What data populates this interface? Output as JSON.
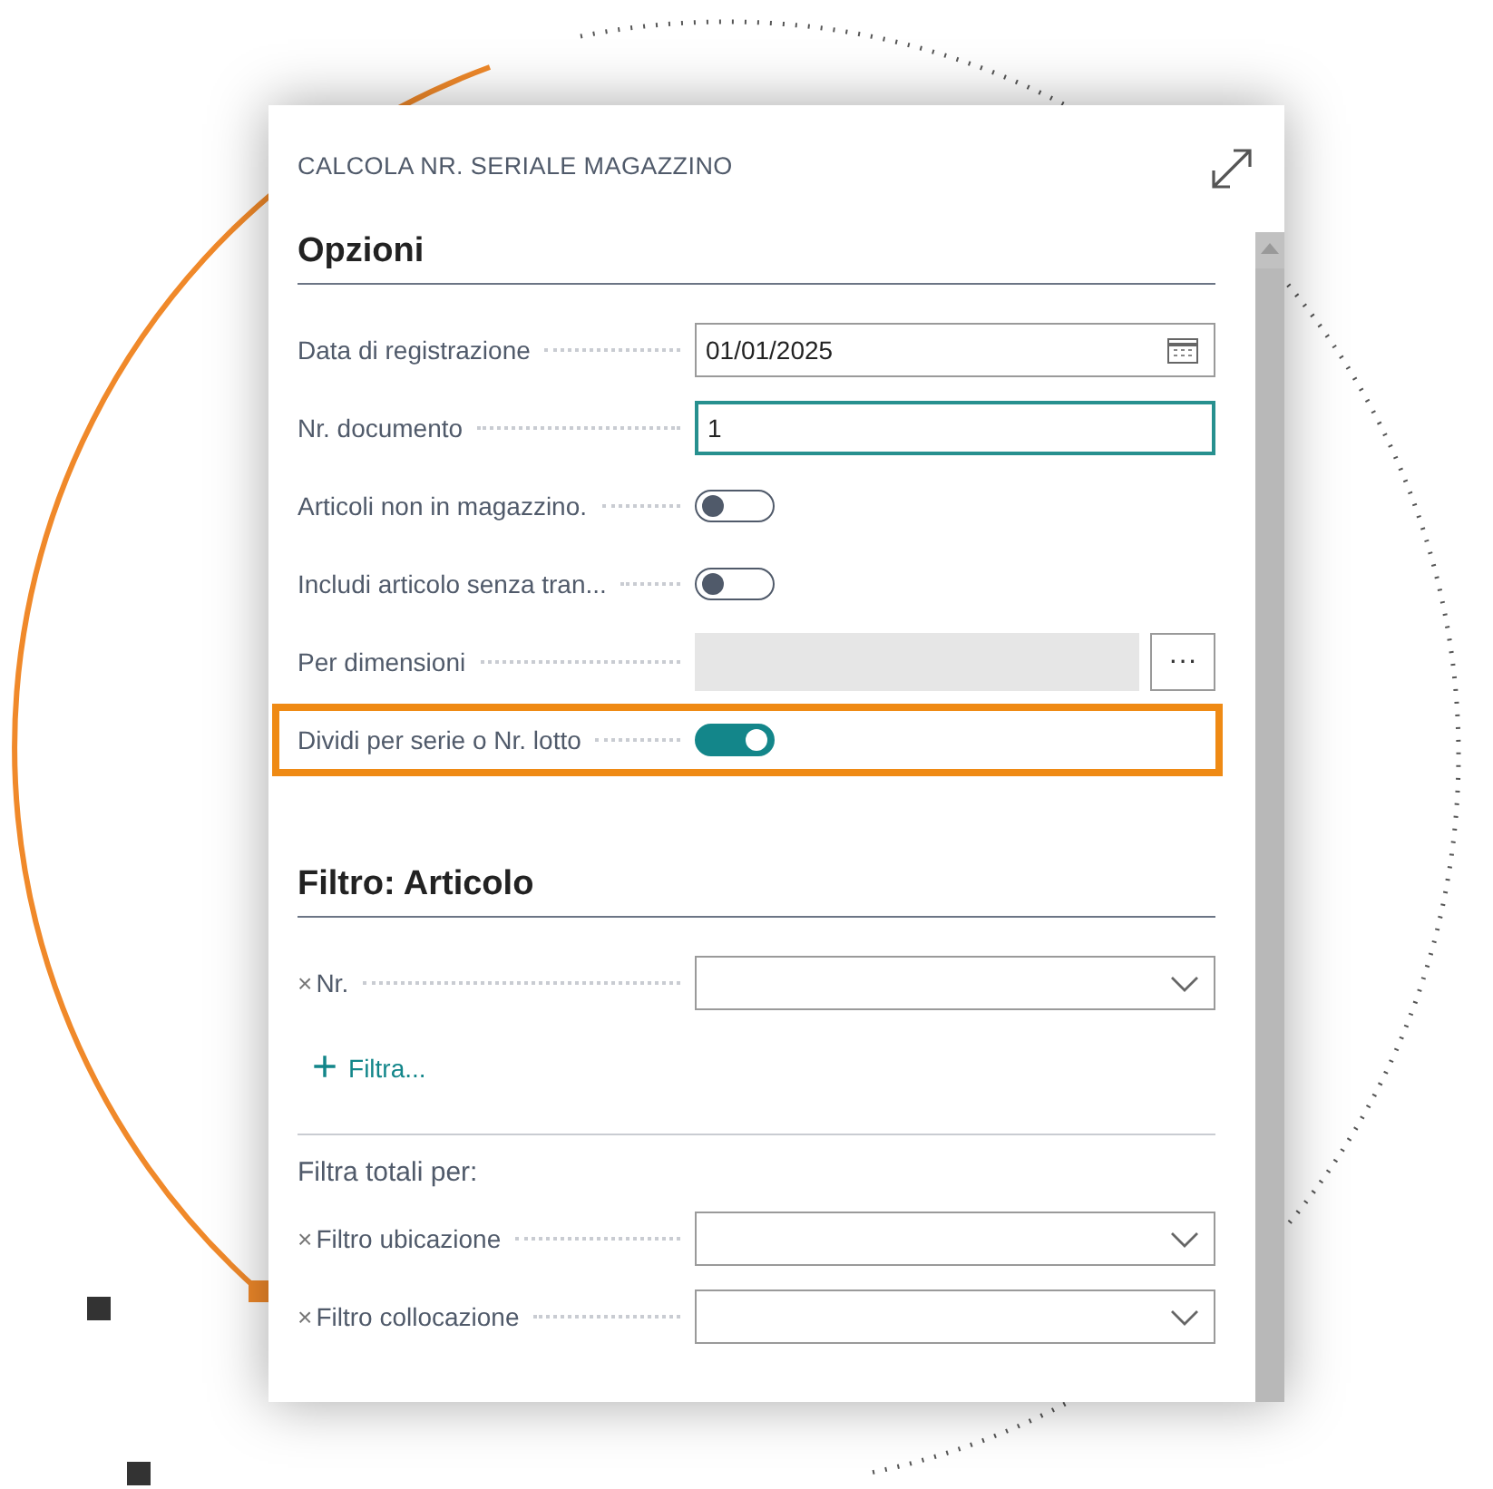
{
  "dialog": {
    "title": "CALCOLA NR. SERIALE MAGAZZINO"
  },
  "options": {
    "heading": "Opzioni",
    "fields": [
      {
        "kind": "date",
        "label": "Data di registrazione",
        "value": "01/01/2025",
        "focused": false,
        "highlighted": false
      },
      {
        "kind": "text",
        "label": "Nr. documento",
        "value": "1",
        "focused": true,
        "highlighted": false
      },
      {
        "kind": "toggle",
        "label": "Articoli non in magazzino.",
        "on": false,
        "highlighted": false
      },
      {
        "kind": "toggle",
        "label": "Includi articolo senza tran...",
        "on": false,
        "highlighted": false
      },
      {
        "kind": "lookup",
        "label": "Per dimensioni",
        "button": "···",
        "highlighted": false
      },
      {
        "kind": "toggle",
        "label": "Dividi per serie o Nr. lotto",
        "on": true,
        "highlighted": true
      }
    ]
  },
  "filter": {
    "heading": "Filtro: Articolo",
    "fields": [
      {
        "remove": "×",
        "label": "Nr."
      }
    ],
    "add_filter": {
      "icon": "+",
      "label": "Filtra..."
    }
  },
  "totals": {
    "heading": "Filtra totali per:",
    "fields": [
      {
        "remove": "×",
        "label": "Filtro ubicazione"
      },
      {
        "remove": "×",
        "label": "Filtro collocazione"
      }
    ]
  }
}
